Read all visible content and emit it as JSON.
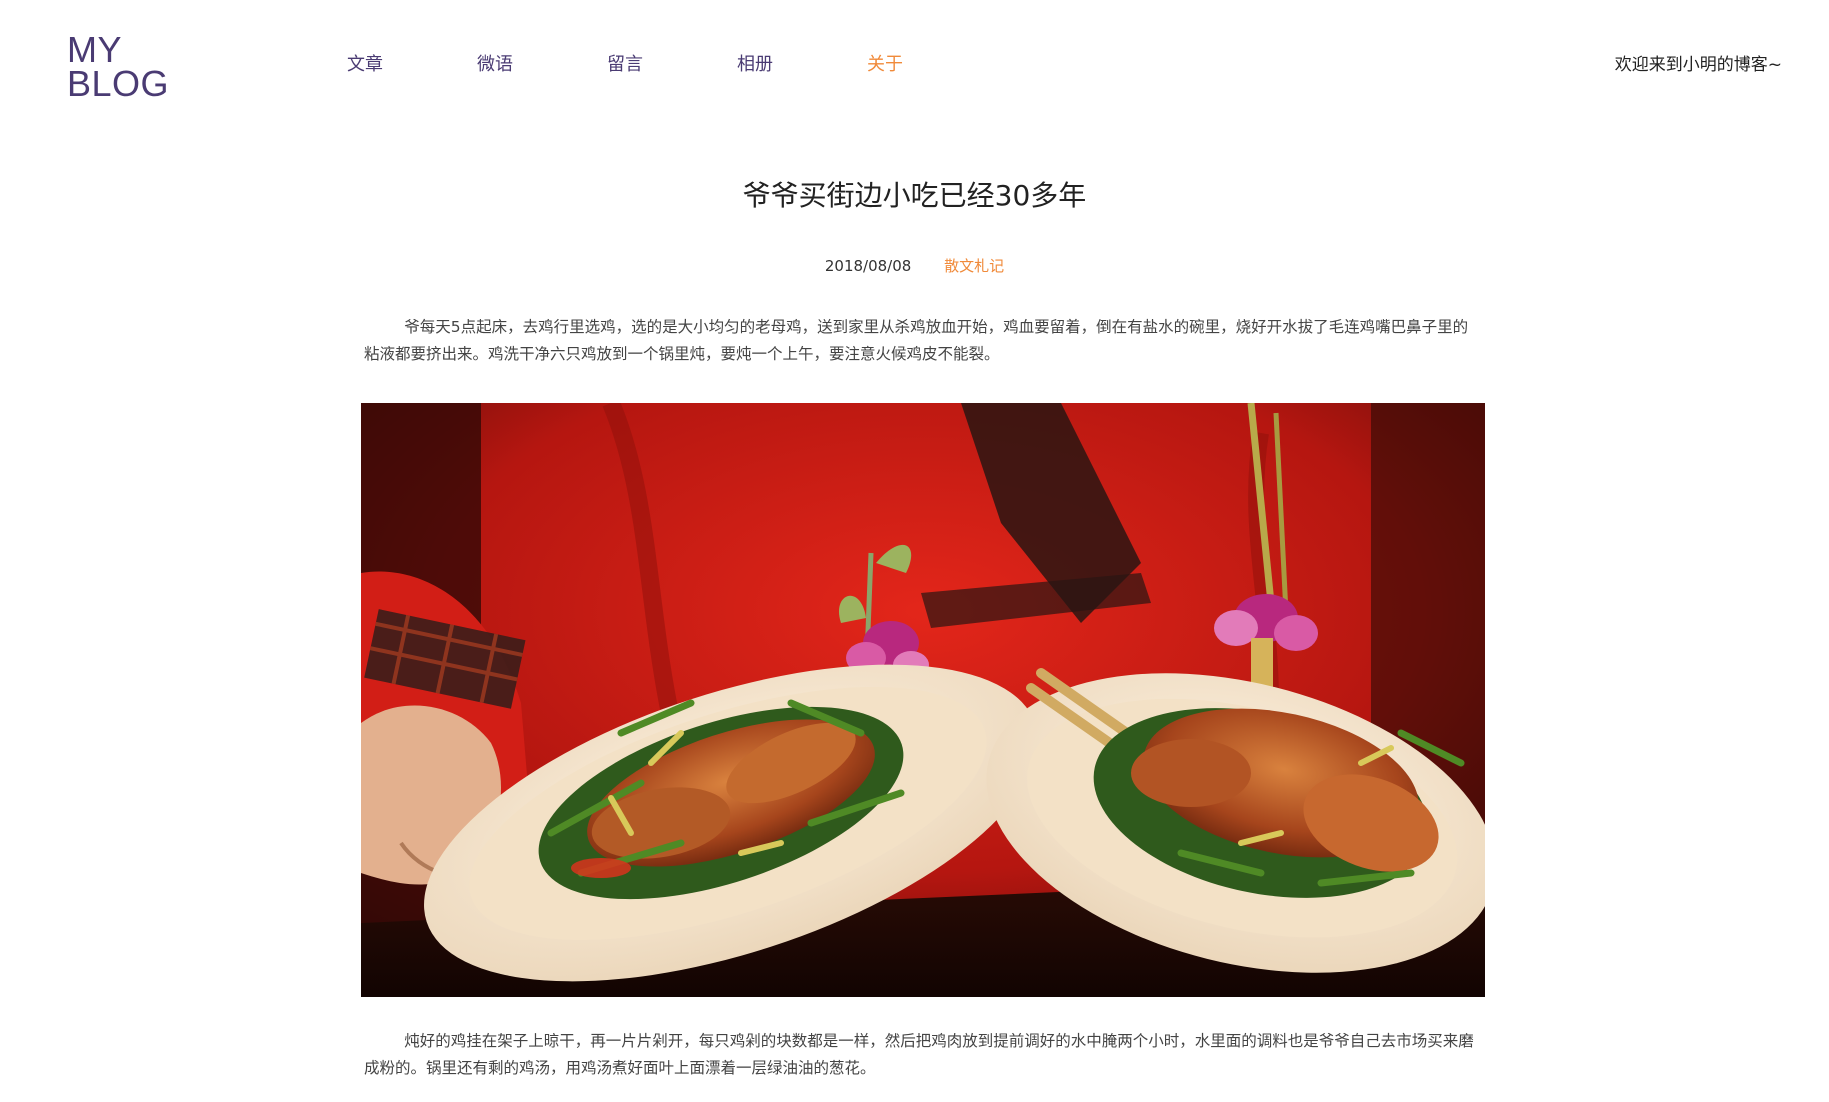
{
  "header": {
    "logo_line1": "MY",
    "logo_line2": "BLOG",
    "nav": [
      {
        "label": "文章",
        "active": false
      },
      {
        "label": "微语",
        "active": false
      },
      {
        "label": "留言",
        "active": false
      },
      {
        "label": "相册",
        "active": false
      },
      {
        "label": "关于",
        "active": true
      }
    ],
    "welcome": "欢迎来到小明的博客~"
  },
  "article": {
    "title": "爷爷买街边小吃已经30多年",
    "date": "2018/08/08",
    "category": "散文札记",
    "paragraph1": "爷每天5点起床，去鸡行里选鸡，选的是大小均匀的老母鸡，送到家里从杀鸡放血开始，鸡血要留着，倒在有盐水的碗里，烧好开水拔了毛连鸡嘴巴鼻子里的粘液都要挤出来。鸡洗干净六只鸡放到一个锅里炖，要炖一个上午，要注意火候鸡皮不能裂。",
    "paragraph2": "炖好的鸡挂在架子上晾干，再一片片剁开，每只鸡剁的块数都是一样，然后把鸡肉放到提前调好的水中腌两个小时，水里面的调料也是爷爷自己去市场买来磨成粉的。锅里还有剩的鸡汤，用鸡汤煮好面叶上面漂着一层绿油油的葱花。"
  },
  "colors": {
    "brand": "#4a3b73",
    "accent": "#f08a3a"
  }
}
